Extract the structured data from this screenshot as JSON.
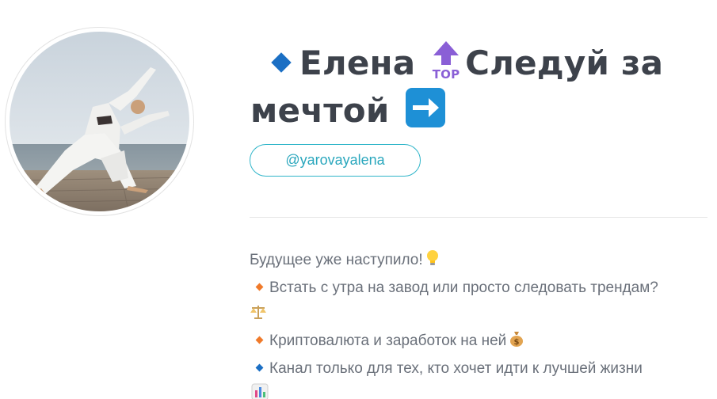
{
  "profile": {
    "name_part1": "Елена",
    "name_part2": "Следуй за",
    "name_part3": "мечтой",
    "handle": "@yarovayalena",
    "avatar_alt": "profile-photo"
  },
  "icons": {
    "title_diamond": "large-blue-diamond-icon",
    "top": "top-arrow-icon",
    "arrow": "right-arrow-icon",
    "bulb": "light-bulb-icon",
    "scales": "balance-scale-icon",
    "moneybag": "money-bag-icon",
    "chart": "bar-chart-icon"
  },
  "bio": {
    "line1": "Будущее уже наступило!",
    "line2": "Встать с утра на завод или просто следовать трендам?",
    "line3": "Криптовалюта и заработок на ней",
    "line4": "Канал только для тех, кто хочет идти к лучшей жизни"
  },
  "colors": {
    "accent": "#2aa7bd",
    "title": "#3d424b",
    "text": "#6a707a",
    "diamond_blue": "#1b6fc4",
    "diamond_orange": "#f07a2a"
  }
}
